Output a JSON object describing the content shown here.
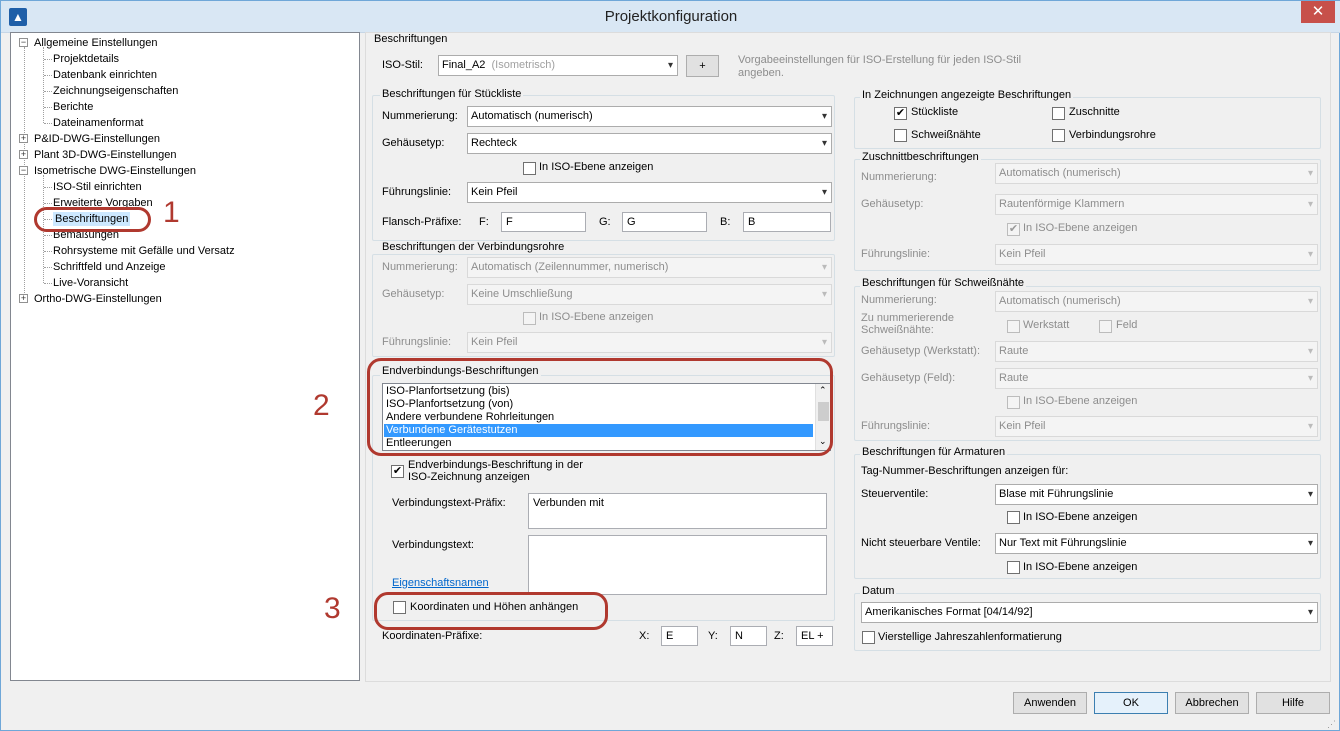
{
  "window": {
    "title": "Projektkonfiguration"
  },
  "tree": {
    "items": [
      {
        "label": "Allgemeine Einstellungen",
        "level": 0,
        "expander": "−"
      },
      {
        "label": "Projektdetails",
        "level": 1
      },
      {
        "label": "Datenbank einrichten",
        "level": 1
      },
      {
        "label": "Zeichnungseigenschaften",
        "level": 1
      },
      {
        "label": "Berichte",
        "level": 1
      },
      {
        "label": "Dateinamenformat",
        "level": 1
      },
      {
        "label": "P&ID-DWG-Einstellungen",
        "level": 0,
        "expander": "+"
      },
      {
        "label": "Plant 3D-DWG-Einstellungen",
        "level": 0,
        "expander": "+"
      },
      {
        "label": "Isometrische DWG-Einstellungen",
        "level": 0,
        "expander": "−"
      },
      {
        "label": "ISO-Stil einrichten",
        "level": 1
      },
      {
        "label": "Erweiterte Vorgaben",
        "level": 1
      },
      {
        "label": "Beschriftungen",
        "level": 1,
        "selected": true
      },
      {
        "label": "Bemaßungen",
        "level": 1
      },
      {
        "label": "Rohrsysteme mit Gefälle und Versatz",
        "level": 1
      },
      {
        "label": "Schriftfeld und Anzeige",
        "level": 1
      },
      {
        "label": "Live-Voransicht",
        "level": 1
      },
      {
        "label": "Ortho-DWG-Einstellungen",
        "level": 0,
        "expander": "+"
      }
    ]
  },
  "header": {
    "section": "Beschriftungen",
    "iso_stil_label": "ISO-Stil:",
    "iso_stil_value": "Final_A2",
    "iso_stil_suffix": "(Isometrisch)",
    "add_label": "+",
    "hint": "Vorgabeeinstellungen für ISO-Erstellung für jeden ISO-Stil angeben."
  },
  "stueckliste": {
    "title": "Beschriftungen für Stückliste",
    "nummerierung_label": "Nummerierung:",
    "nummerierung_value": "Automatisch (numerisch)",
    "gehaeuse_label": "Gehäusetyp:",
    "gehaeuse_value": "Rechteck",
    "iso_ebene": "In ISO-Ebene anzeigen",
    "fuehrung_label": "Führungslinie:",
    "fuehrung_value": "Kein Pfeil",
    "flansch_label": "Flansch-Präfixe:",
    "f_label": "F:",
    "f_value": "F",
    "g_label": "G:",
    "g_value": "G",
    "b_label": "B:",
    "b_value": "B"
  },
  "verbindungsrohre": {
    "title": "Beschriftungen der Verbindungsrohre",
    "nummerierung_label": "Nummerierung:",
    "nummerierung_value": "Automatisch (Zeilennummer, numerisch)",
    "gehaeuse_label": "Gehäusetyp:",
    "gehaeuse_value": "Keine Umschließung",
    "iso_ebene": "In ISO-Ebene anzeigen",
    "fuehrung_label": "Führungslinie:",
    "fuehrung_value": "Kein Pfeil"
  },
  "endverbindung": {
    "title": "Endverbindungs-Beschriftungen",
    "list": [
      "ISO-Planfortsetzung (bis)",
      "ISO-Planfortsetzung (von)",
      "Andere verbundene Rohrleitungen",
      "Verbundene Gerätestutzen",
      "Entleerungen"
    ],
    "selected_index": 3,
    "show_in_iso_line1": "Endverbindungs-Beschriftung in der",
    "show_in_iso_line2": "ISO-Zeichnung anzeigen",
    "prefix_label": "Verbindungstext-Präfix:",
    "prefix_value": "Verbunden mit",
    "text_label": "Verbindungstext:",
    "text_value": "",
    "link": "Eigenschaftsnamen",
    "koordinaten": "Koordinaten und Höhen anhängen",
    "koord_prefix_label": "Koordinaten-Präfixe:",
    "x_label": "X:",
    "x_value": "E",
    "y_label": "Y:",
    "y_value": "N",
    "z_label": "Z:",
    "z_value": "EL +"
  },
  "in_zeichnungen": {
    "title": "In Zeichnungen angezeigte Beschriftungen",
    "stueckliste": "Stückliste",
    "zuschnitte": "Zuschnitte",
    "schweissnaehte": "Schweißnähte",
    "verbindungsrohre": "Verbindungsrohre"
  },
  "zuschnitt": {
    "title": "Zuschnittbeschriftungen",
    "nummerierung_label": "Nummerierung:",
    "nummerierung_value": "Automatisch (numerisch)",
    "gehaeuse_label": "Gehäusetyp:",
    "gehaeuse_value": "Rautenförmige Klammern",
    "iso_ebene": "In ISO-Ebene anzeigen",
    "fuehrung_label": "Führungslinie:",
    "fuehrung_value": "Kein Pfeil"
  },
  "schweiss": {
    "title": "Beschriftungen für Schweißnähte",
    "nummerierung_label": "Nummerierung:",
    "nummerierung_value": "Automatisch (numerisch)",
    "zu_nummerierende_1": "Zu nummerierende",
    "zu_nummerierende_2": "Schweißnähte:",
    "werkstatt": "Werkstatt",
    "feld": "Feld",
    "gehaeuse_werkstatt_label": "Gehäusetyp (Werkstatt):",
    "gehaeuse_werkstatt_value": "Raute",
    "gehaeuse_feld_label": "Gehäusetyp (Feld):",
    "gehaeuse_feld_value": "Raute",
    "iso_ebene": "In ISO-Ebene anzeigen",
    "fuehrung_label": "Führungslinie:",
    "fuehrung_value": "Kein Pfeil"
  },
  "armaturen": {
    "title": "Beschriftungen für Armaturen",
    "tag_label": "Tag-Nummer-Beschriftungen anzeigen für:",
    "steuer_label": "Steuerventile:",
    "steuer_value": "Blase mit Führungslinie",
    "iso_ebene_1": "In ISO-Ebene anzeigen",
    "nicht_label": "Nicht steuerbare Ventile:",
    "nicht_value": "Nur Text mit Führungslinie",
    "iso_ebene_2": "In ISO-Ebene anzeigen"
  },
  "datum": {
    "title": "Datum",
    "format_value": "Amerikanisches Format [04/14/92]",
    "vierstellig": "Vierstellige Jahreszahlenformatierung"
  },
  "annotations": {
    "n1": "1",
    "n2": "2",
    "n3": "3"
  },
  "footer": {
    "anwenden": "Anwenden",
    "ok": "OK",
    "abbrechen": "Abbrechen",
    "hilfe": "Hilfe"
  }
}
